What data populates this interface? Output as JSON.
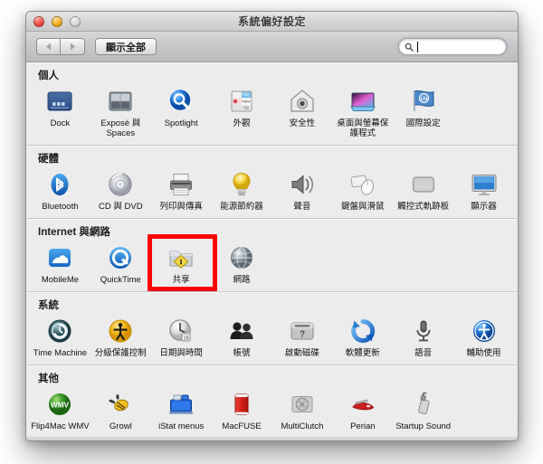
{
  "window": {
    "title": "系統偏好設定",
    "traffic_lights": [
      "close",
      "minimize",
      "zoom"
    ]
  },
  "toolbar": {
    "back_label": "◀",
    "forward_label": "▶",
    "show_all_label": "顯示全部",
    "search": {
      "value": "",
      "placeholder": "",
      "icon": "search-icon"
    }
  },
  "sections": [
    {
      "id": "personal",
      "title": "個人",
      "items": [
        {
          "label": "Dock",
          "icon": "dock-icon"
        },
        {
          "label": "Exposé 與 Spaces",
          "icon": "expose-spaces-icon"
        },
        {
          "label": "Spotlight",
          "icon": "spotlight-icon"
        },
        {
          "label": "外觀",
          "icon": "appearance-icon"
        },
        {
          "label": "安全性",
          "icon": "security-icon"
        },
        {
          "label": "桌面與螢幕保護程式",
          "icon": "desktop-screensaver-icon"
        },
        {
          "label": "國際設定",
          "icon": "international-icon"
        }
      ]
    },
    {
      "id": "hardware",
      "title": "硬體",
      "items": [
        {
          "label": "Bluetooth",
          "icon": "bluetooth-icon"
        },
        {
          "label": "CD 與 DVD",
          "icon": "cd-dvd-icon"
        },
        {
          "label": "列印與傳真",
          "icon": "print-fax-icon"
        },
        {
          "label": "能源節約器",
          "icon": "energy-saver-icon"
        },
        {
          "label": "聲音",
          "icon": "sound-icon"
        },
        {
          "label": "鍵盤與滑鼠",
          "icon": "keyboard-mouse-icon"
        },
        {
          "label": "觸控式軌跡板",
          "icon": "trackpad-icon"
        },
        {
          "label": "顯示器",
          "icon": "displays-icon"
        }
      ]
    },
    {
      "id": "internet",
      "title": "Internet 與網路",
      "items": [
        {
          "label": "MobileMe",
          "icon": "mobileme-icon"
        },
        {
          "label": "QuickTime",
          "icon": "quicktime-icon"
        },
        {
          "label": "共享",
          "icon": "sharing-icon",
          "highlighted": true
        },
        {
          "label": "網路",
          "icon": "network-icon"
        }
      ]
    },
    {
      "id": "system",
      "title": "系統",
      "items": [
        {
          "label": "Time Machine",
          "icon": "time-machine-icon"
        },
        {
          "label": "分級保護控制",
          "icon": "parental-controls-icon"
        },
        {
          "label": "日期與時間",
          "icon": "date-time-icon"
        },
        {
          "label": "帳號",
          "icon": "accounts-icon"
        },
        {
          "label": "啟動磁碟",
          "icon": "startup-disk-icon"
        },
        {
          "label": "軟體更新",
          "icon": "software-update-icon"
        },
        {
          "label": "語音",
          "icon": "speech-icon"
        },
        {
          "label": "輔助使用",
          "icon": "universal-access-icon"
        }
      ]
    },
    {
      "id": "other",
      "title": "其他",
      "items": [
        {
          "label": "Flip4Mac WMV",
          "icon": "flip4mac-icon"
        },
        {
          "label": "Growl",
          "icon": "growl-icon"
        },
        {
          "label": "iStat menus",
          "icon": "istat-menus-icon"
        },
        {
          "label": "MacFUSE",
          "icon": "macfuse-icon"
        },
        {
          "label": "MultiClutch",
          "icon": "multiclutch-icon"
        },
        {
          "label": "Perian",
          "icon": "perian-icon"
        },
        {
          "label": "Startup Sound",
          "icon": "startup-sound-icon"
        }
      ]
    }
  ],
  "annotation": {
    "highlight_color": "#ff0000",
    "highlight_target": "共享"
  }
}
